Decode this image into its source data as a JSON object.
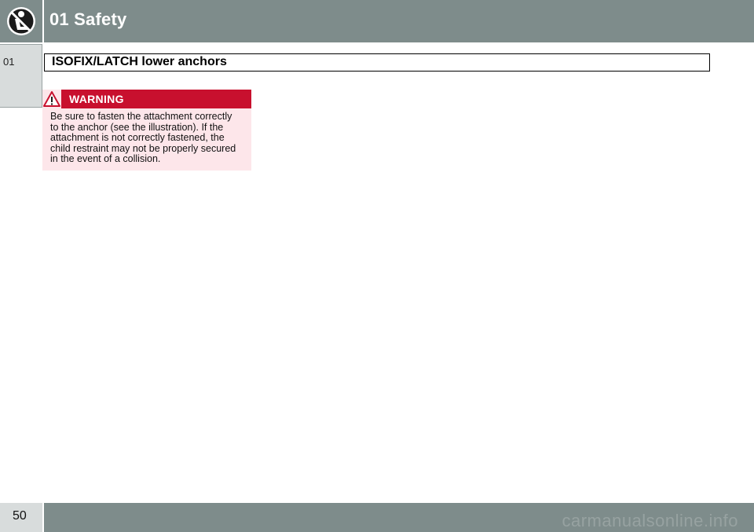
{
  "header": {
    "title": "01 Safety",
    "icon": "child-seat-icon"
  },
  "chapter_tab": {
    "label": "01"
  },
  "section": {
    "title": "ISOFIX/LATCH lower anchors"
  },
  "warning": {
    "icon": "warning-triangle-icon",
    "title": "WARNING",
    "lines": [
      "Be sure to fasten the attachment correctly",
      "to the anchor (see the illustration). If the",
      "attachment is not correctly fastened, the",
      "child restraint may not be properly secured",
      "in the event of a collision."
    ]
  },
  "footer": {
    "page_number": "50",
    "watermark": "carmanualsonline.info"
  },
  "colors": {
    "header_bg": "#7e8c8b",
    "warning_red": "#c8102e",
    "warning_bg": "#fde6ea",
    "tab_bg": "#d8dcdc"
  }
}
